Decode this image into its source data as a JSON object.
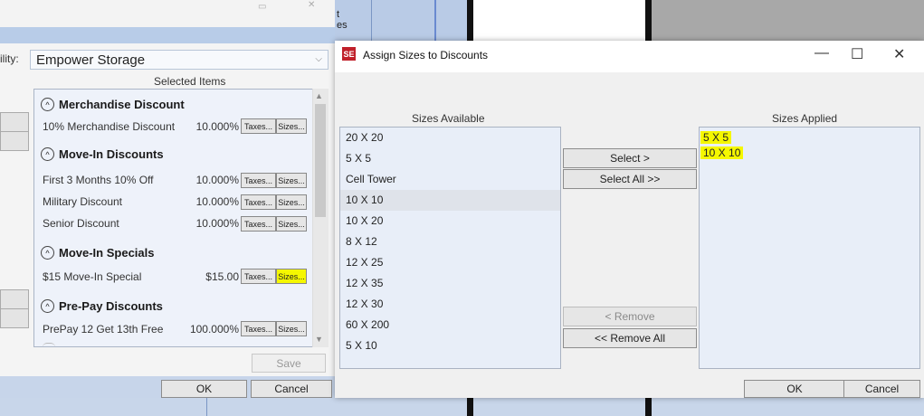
{
  "background": {
    "top_fragment_line1": "t",
    "top_fragment_line2": "es"
  },
  "left_window": {
    "facility_label": "ility:",
    "facility_value": "Empower Storage",
    "selected_items_title": "Selected Items",
    "groups": [
      {
        "title": "Merchandise Discount",
        "items": [
          {
            "name": "10% Merchandise Discount",
            "value": "10.000%",
            "taxes": "Taxes...",
            "sizes": "Sizes..."
          }
        ]
      },
      {
        "title": "Move-In Discounts",
        "items": [
          {
            "name": "First 3 Months 10% Off",
            "value": "10.000%",
            "taxes": "Taxes...",
            "sizes": "Sizes..."
          },
          {
            "name": "Military Discount",
            "value": "10.000%",
            "taxes": "Taxes...",
            "sizes": "Sizes..."
          },
          {
            "name": "Senior Discount",
            "value": "10.000%",
            "taxes": "Taxes...",
            "sizes": "Sizes..."
          }
        ]
      },
      {
        "title": "Move-In Specials",
        "items": [
          {
            "name": "$15 Move-In Special",
            "value": "$15.00",
            "taxes": "Taxes...",
            "sizes": "Sizes..."
          }
        ]
      },
      {
        "title": "Pre-Pay Discounts",
        "items": [
          {
            "name": "PrePay 12 Get 13th Free",
            "value": "100.000%",
            "taxes": "Taxes...",
            "sizes": "Sizes..."
          }
        ]
      }
    ],
    "save_label": "Save",
    "ok_label": "OK",
    "cancel_label": "Cancel",
    "highlight_color": "#f5f700"
  },
  "dialog": {
    "title": "Assign Sizes to Discounts",
    "minimize_glyph": "—",
    "maximize_glyph": "☐",
    "close_glyph": "✕",
    "sizes_available_label": "Sizes Available",
    "sizes_applied_label": "Sizes Applied",
    "sizes_available": [
      "20 X 20",
      "5 X 5",
      "Cell Tower",
      "10 X 10",
      "10 X 20",
      "8 X 12",
      "12 X 25",
      "12 X 35",
      "12 X 30",
      "60 X 200",
      "5 X 10"
    ],
    "sizes_applied": [
      "5 X 5",
      "10 X 10"
    ],
    "select_label": "Select >",
    "select_all_label": "Select All >>",
    "remove_label": "< Remove",
    "remove_all_label": "<< Remove All",
    "ok_label": "OK",
    "cancel_label": "Cancel"
  }
}
